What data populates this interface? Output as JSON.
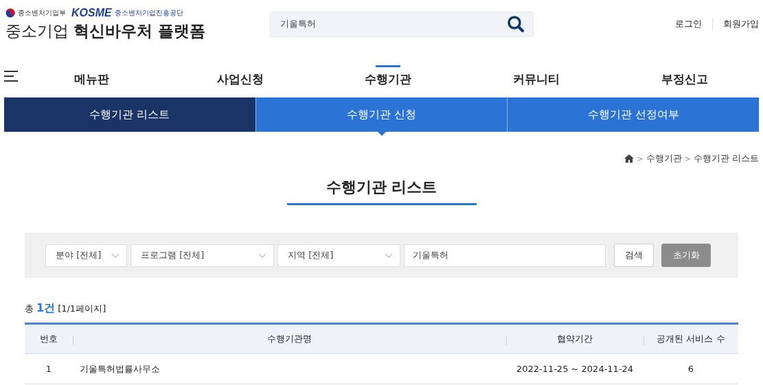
{
  "header": {
    "ministry": "중소벤처기업부",
    "agency_logo": "KOSME",
    "agency": "중소벤처기업진흥공단",
    "site_title_plain": "중소기업",
    "site_title_bold": "혁신바우처 플랫폼",
    "search": {
      "value": "기울특허"
    },
    "links": [
      "로그인",
      "회원가입"
    ]
  },
  "nav": {
    "items": [
      {
        "label": "메뉴판",
        "selected": false
      },
      {
        "label": "사업신청",
        "selected": false
      },
      {
        "label": "수행기관",
        "selected": true
      },
      {
        "label": "커뮤니티",
        "selected": false
      },
      {
        "label": "부정신고",
        "selected": false
      }
    ]
  },
  "subtabs": [
    {
      "label": "수행기관 리스트",
      "selected": true,
      "pointer": false
    },
    {
      "label": "수행기관 신청",
      "selected": false,
      "pointer": true
    },
    {
      "label": "수행기관 선정여부",
      "selected": false,
      "pointer": false
    }
  ],
  "breadcrumb": {
    "separator": ">",
    "items": [
      "수행기관",
      "수행기관 리스트"
    ]
  },
  "page_title": "수행기관 리스트",
  "filters": {
    "selects": [
      "분야 [전체]",
      "프로그램 [전체]",
      "지역 [전체]"
    ],
    "keyword": "기울특허",
    "buttons": [
      {
        "label": "검색",
        "kind": "primary"
      },
      {
        "label": "초기화",
        "kind": "reset"
      }
    ]
  },
  "summary": {
    "prefix": "총",
    "count": "1건",
    "pages": "[1/1페이지]"
  },
  "table": {
    "columns": [
      "번호",
      "수행기관명",
      "협약기간",
      "공개된 서비스 수"
    ],
    "rows": [
      [
        "1",
        "기울특허법률사무소",
        "2022-11-25 ~ 2024-11-24",
        "6"
      ]
    ]
  }
}
